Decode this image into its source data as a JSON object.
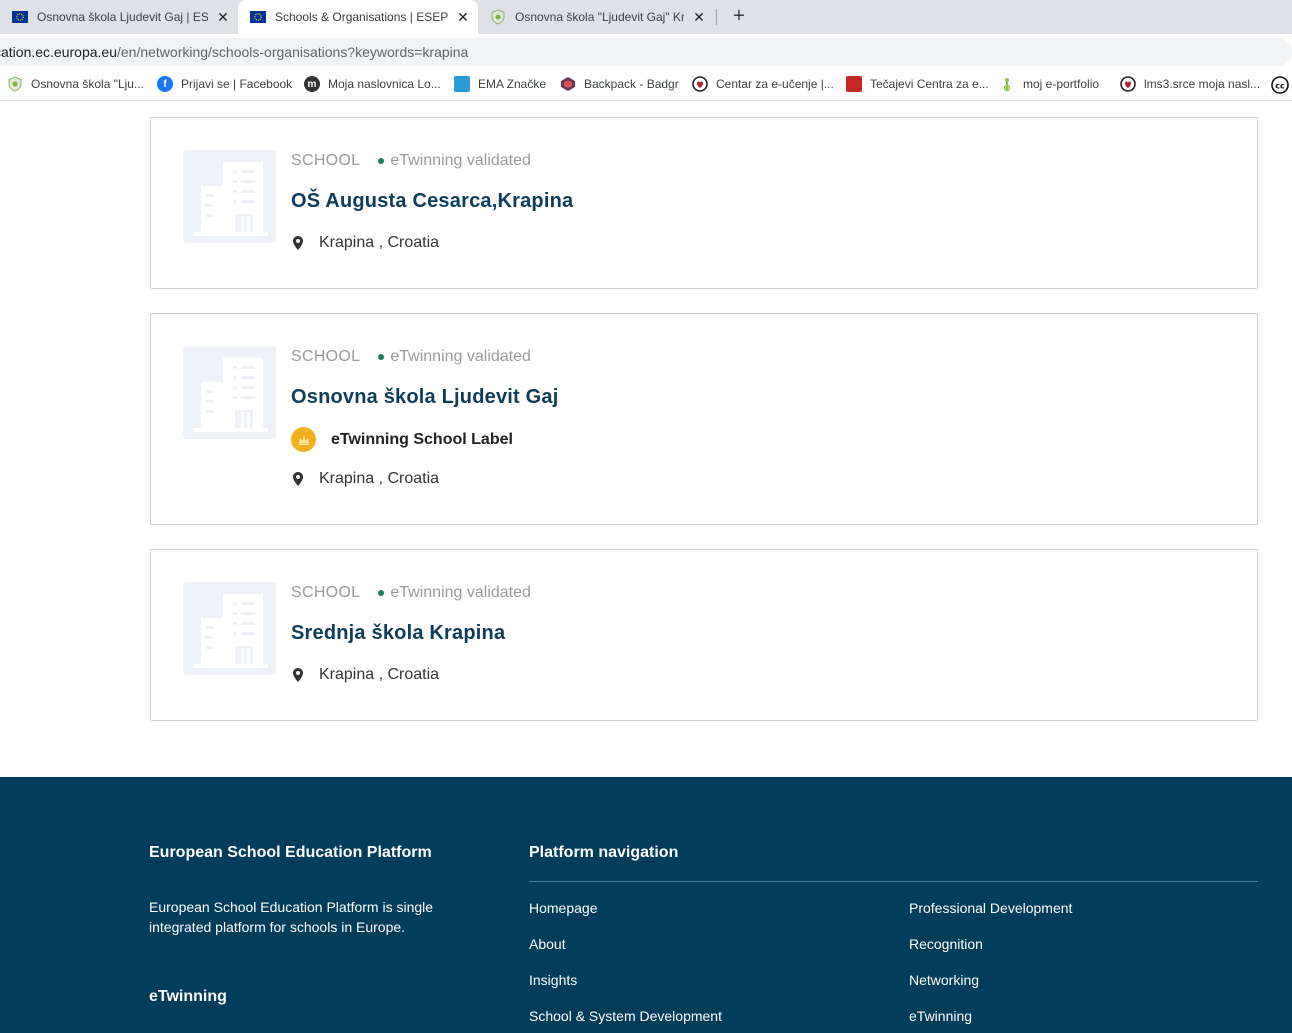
{
  "browser": {
    "tabs": [
      {
        "title": "Osnovna škola Ljudevit Gaj | ESEP",
        "active": false,
        "icon": "eu-flag-icon"
      },
      {
        "title": "Schools & Organisations | ESEP",
        "active": true,
        "icon": "eu-flag-icon"
      },
      {
        "title": "Osnovna škola \"Ljudevit Gaj\" Krapina",
        "active": false,
        "icon": "shield-icon"
      }
    ],
    "new_tab_label": "+",
    "close_glyph": "✕",
    "url_prefix": "cation.ec.europa.eu",
    "url_path": "/en/networking/schools-organisations?keywords=krapina",
    "bookmarks": [
      {
        "label": "Osnovna škola \"Lju...",
        "icon": "shield-icon",
        "color": "#7cb342"
      },
      {
        "label": "Prijavi se | Facebook",
        "icon": "facebook-icon",
        "color": "#1877f2"
      },
      {
        "label": "Moja naslovnica Lo...",
        "icon": "moodle-icon",
        "color": "#333333"
      },
      {
        "label": "EMA Značke",
        "icon": "ema-icon",
        "color": "#2b9bd8"
      },
      {
        "label": "Backpack - Badgr",
        "icon": "badgr-icon",
        "color": "#6b3a5c"
      },
      {
        "label": "Centar za e-učenje |...",
        "icon": "srce-icon",
        "color": "#b0232a"
      },
      {
        "label": "Tečajevi Centra za e...",
        "icon": "srce-courses-icon",
        "color": "#c62828"
      },
      {
        "label": "moj e-portfolio",
        "icon": "eportfolio-icon",
        "color": "#8bc34a"
      },
      {
        "label": "lms3.srce moja nasl...",
        "icon": "lms-icon",
        "color": "#b0232a"
      }
    ]
  },
  "results": [
    {
      "type": "SCHOOL",
      "status": "eTwinning validated",
      "name": "OŠ Augusta Cesarca,Krapina",
      "label": null,
      "location": "Krapina , Croatia"
    },
    {
      "type": "SCHOOL",
      "status": "eTwinning validated",
      "name": "Osnovna škola Ljudevit Gaj",
      "label": "eTwinning School Label",
      "location": "Krapina , Croatia"
    },
    {
      "type": "SCHOOL",
      "status": "eTwinning validated",
      "name": "Srednja škola Krapina",
      "label": null,
      "location": "Krapina , Croatia"
    }
  ],
  "footer": {
    "about_title": "European School Education Platform",
    "about_text": "European School Education Platform is single integrated platform for schools in Europe.",
    "etwinning_title": "eTwinning",
    "nav_title": "Platform navigation",
    "nav_col1": [
      "Homepage",
      "About",
      "Insights",
      "School & System Development"
    ],
    "nav_col2": [
      "Professional Development",
      "Recognition",
      "Networking",
      "eTwinning"
    ]
  },
  "colors": {
    "title": "#0c3d5a",
    "validated_dot": "#1b8060",
    "footer_bg": "#003d5b",
    "medal": "#f2b01e"
  }
}
